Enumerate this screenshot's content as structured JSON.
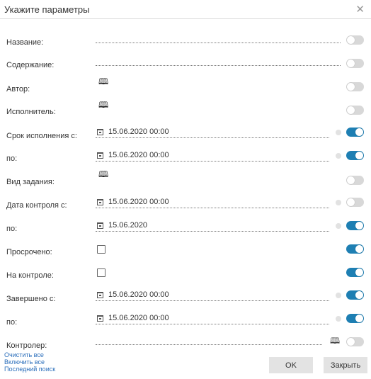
{
  "dialog": {
    "title": "Укажите параметры",
    "close_glyph": "✕"
  },
  "fields": {
    "name": {
      "label": "Название:",
      "toggle_on": false
    },
    "content": {
      "label": "Содержание:",
      "toggle_on": false
    },
    "author": {
      "label": "Автор:",
      "icon": "address-book-icon",
      "toggle_on": false
    },
    "executor": {
      "label": "Исполнитель:",
      "icon": "address-book-icon",
      "toggle_on": false
    },
    "due_from": {
      "label": "Срок исполнения с:",
      "value": "15.06.2020 00:00",
      "toggle_on": true
    },
    "due_to": {
      "label": "по:",
      "value": "15.06.2020 00:00",
      "toggle_on": true
    },
    "task_type": {
      "label": "Вид задания:",
      "icon": "address-book-icon",
      "toggle_on": false
    },
    "control_from": {
      "label": "Дата контроля с:",
      "value": "15.06.2020 00:00",
      "toggle_on": false
    },
    "control_to": {
      "label": "по:",
      "value": "15.06.2020",
      "toggle_on": true
    },
    "overdue": {
      "label": "Просрочено:",
      "checked": false,
      "toggle_on": true
    },
    "on_control": {
      "label": "На контроле:",
      "checked": false,
      "toggle_on": true
    },
    "completed_from": {
      "label": "Завершено с:",
      "value": "15.06.2020 00:00",
      "toggle_on": true
    },
    "completed_to": {
      "label": "по:",
      "value": "15.06.2020 00:00",
      "toggle_on": true
    },
    "controller": {
      "label": "Контролер:",
      "icon": "book-icon",
      "toggle_on": false
    }
  },
  "links": {
    "clear_all": "Очистить все",
    "enable_all": "Включить все",
    "last_search": "Последний поиск"
  },
  "buttons": {
    "ok": "OK",
    "close": "Закрыть"
  },
  "colors": {
    "toggle_on": "#1e7fb3",
    "toggle_off": "#d8d8d8",
    "link": "#2a6ebb",
    "button_bg": "#e3e3e3"
  }
}
